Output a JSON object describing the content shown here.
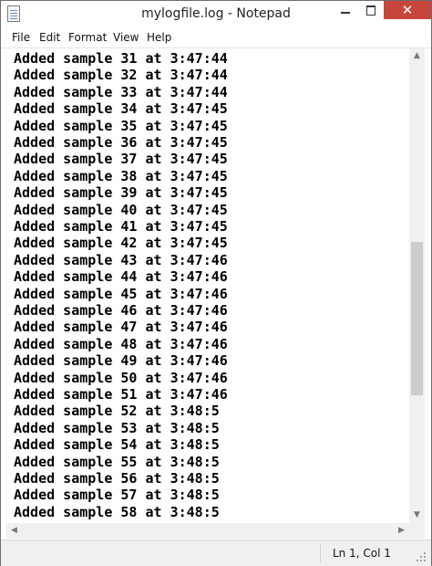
{
  "window": {
    "title": "mylogfile.log - Notepad"
  },
  "title_buttons": {
    "close": "✕"
  },
  "menu": [
    "File",
    "Edit",
    "Format",
    "View",
    "Help"
  ],
  "editor": {
    "lines": [
      "Added sample 31 at 3:47:44",
      "Added sample 32 at 3:47:44",
      "Added sample 33 at 3:47:44",
      "Added sample 34 at 3:47:45",
      "Added sample 35 at 3:47:45",
      "Added sample 36 at 3:47:45",
      "Added sample 37 at 3:47:45",
      "Added sample 38 at 3:47:45",
      "Added sample 39 at 3:47:45",
      "Added sample 40 at 3:47:45",
      "Added sample 41 at 3:47:45",
      "Added sample 42 at 3:47:45",
      "Added sample 43 at 3:47:46",
      "Added sample 44 at 3:47:46",
      "Added sample 45 at 3:47:46",
      "Added sample 46 at 3:47:46",
      "Added sample 47 at 3:47:46",
      "Added sample 48 at 3:47:46",
      "Added sample 49 at 3:47:46",
      "Added sample 50 at 3:47:46",
      "Added sample 51 at 3:47:46",
      "Added sample 52 at 3:48:5",
      "Added sample 53 at 3:48:5",
      "Added sample 54 at 3:48:5",
      "Added sample 55 at 3:48:5",
      "Added sample 56 at 3:48:5",
      "Added sample 57 at 3:48:5",
      "Added sample 58 at 3:48:5"
    ]
  },
  "statusbar": {
    "position": "Ln 1, Col 1"
  },
  "icons": {
    "app": "notepad-icon",
    "minimize": "minimize-icon",
    "maximize": "maximize-icon",
    "close": "close-icon",
    "scroll_up": "▲",
    "scroll_down": "▼",
    "scroll_left": "◀",
    "scroll_right": "▶"
  }
}
